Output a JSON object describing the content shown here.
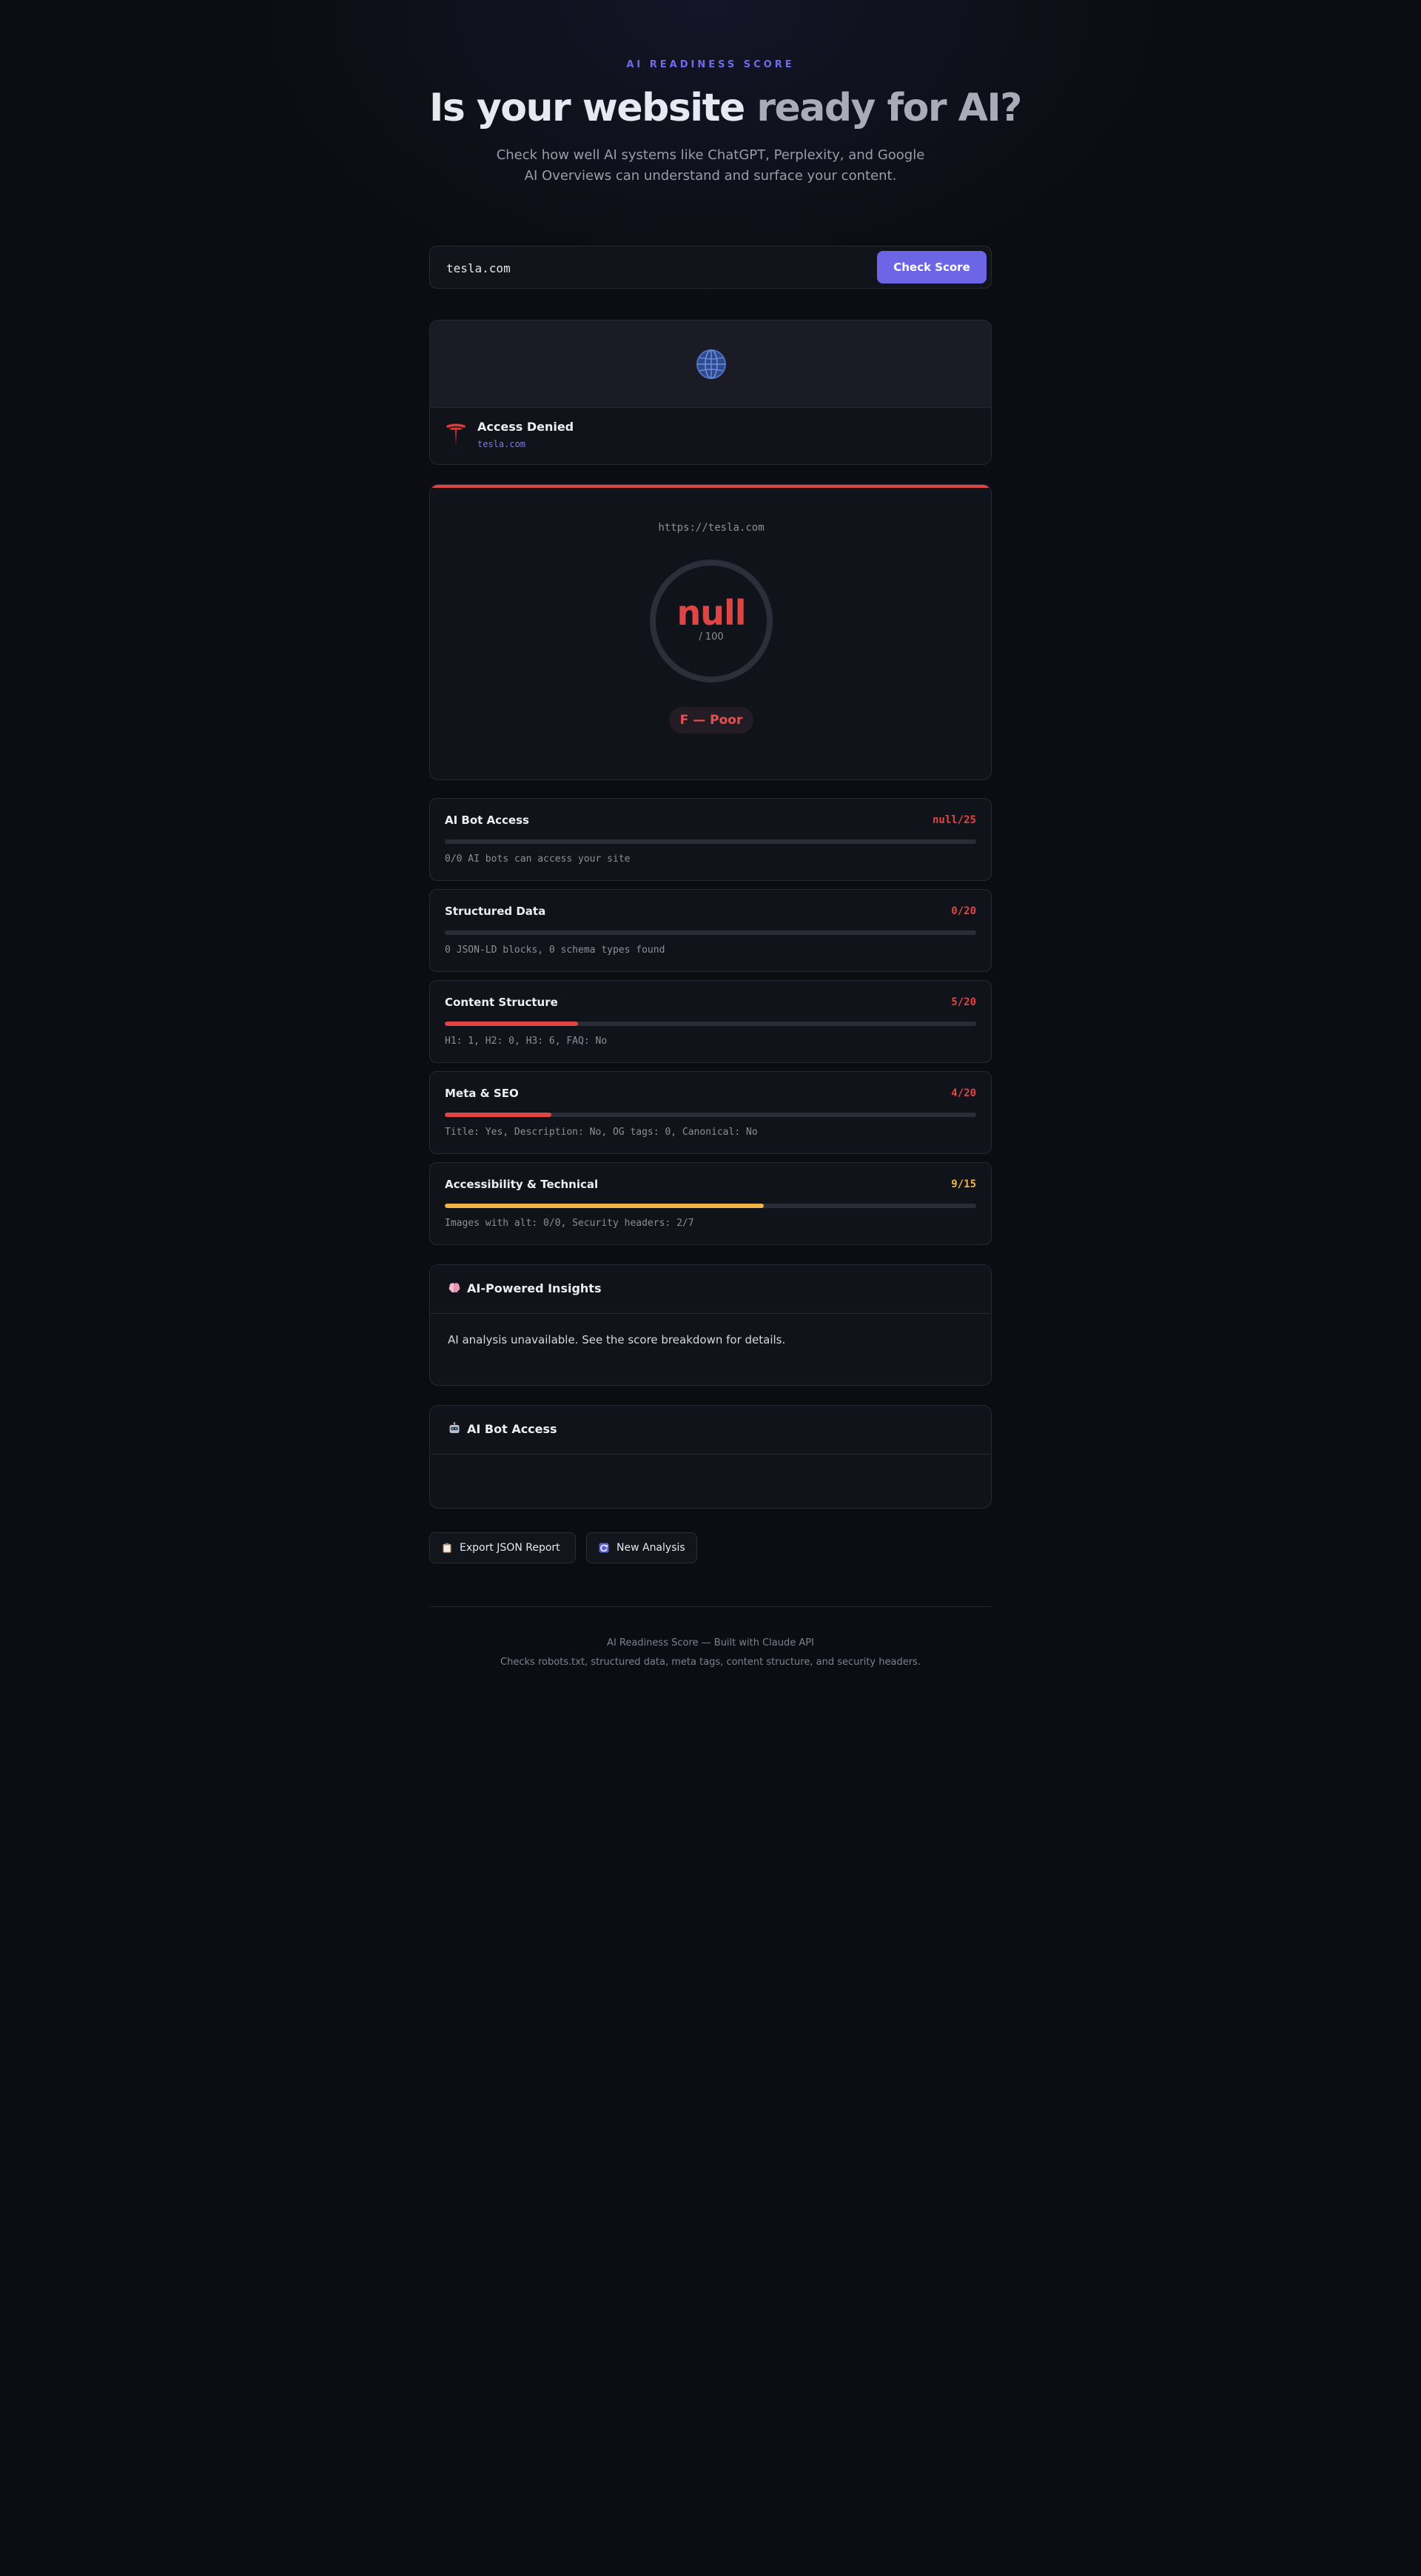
{
  "hero": {
    "eyebrow": "AI READINESS SCORE",
    "title_main": "Is your website ",
    "title_muted": "ready for AI?",
    "subtitle": "Check how well AI systems like ChatGPT, Perplexity, and Google AI Overviews can understand and surface your content."
  },
  "search": {
    "value": "tesla.com",
    "button_label": "Check Score"
  },
  "preview": {
    "icon": "globe-icon",
    "logo": "tesla-logo",
    "site_title": "Access Denied",
    "site_domain": "tesla.com"
  },
  "score": {
    "url": "https://tesla.com",
    "value": "null",
    "max_label": "/ 100",
    "grade": "F — Poor",
    "accent_color": "#e04545"
  },
  "metrics": [
    {
      "name": "AI Bot Access",
      "score_label": "null/25",
      "fraction": 0,
      "detail": "0/0 AI bots can access your site",
      "color": "#e04545"
    },
    {
      "name": "Structured Data",
      "score_label": "0/20",
      "fraction": 0,
      "detail": "0 JSON-LD blocks, 0 schema types found",
      "color": "#e04545"
    },
    {
      "name": "Content Structure",
      "score_label": "5/20",
      "fraction": 0.25,
      "detail": "H1: 1, H2: 0, H3: 6, FAQ: No",
      "color": "#e04545"
    },
    {
      "name": "Meta & SEO",
      "score_label": "4/20",
      "fraction": 0.2,
      "detail": "Title: Yes, Description: No, OG tags: 0, Canonical: No",
      "color": "#e04545"
    },
    {
      "name": "Accessibility & Technical",
      "score_label": "9/15",
      "fraction": 0.6,
      "detail": "Images with alt: 0/0, Security headers: 2/7",
      "color": "#f0b44a"
    }
  ],
  "insights": {
    "icon": "brain-icon",
    "title": "AI-Powered Insights",
    "body": "AI analysis unavailable. See the score breakdown for details."
  },
  "bot_access": {
    "icon": "robot-icon",
    "title": "AI Bot Access"
  },
  "actions": {
    "export_label": "Export JSON Report",
    "export_icon": "clipboard-icon",
    "new_label": "New Analysis",
    "new_icon": "refresh-icon"
  },
  "footer": {
    "line1": "AI Readiness Score — Built with Claude API",
    "line2": "Checks robots.txt, structured data, meta tags, content structure, and security headers."
  }
}
